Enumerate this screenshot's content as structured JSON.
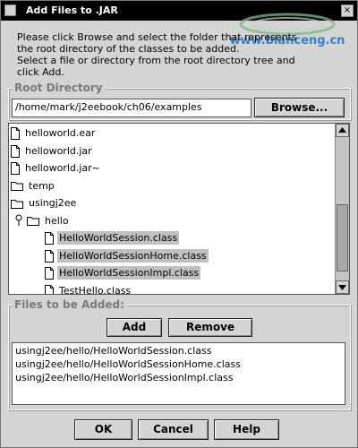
{
  "window": {
    "title": "Add Files to .JAR",
    "close_glyph": "×"
  },
  "watermark": {
    "text": "www.bianceng.cn"
  },
  "instructions": [
    "Please click Browse and select the folder that represents",
    "the root directory of the classes to be added.",
    "Select a file or directory from the root directory tree and",
    "click Add."
  ],
  "root_directory": {
    "group_label": "Root Directory",
    "path_value": "/home/mark/j2eebook/ch06/examples",
    "browse_label": "Browse..."
  },
  "tree": {
    "rows": [
      {
        "label": "helloworld.ear",
        "icon": "file-icon",
        "selected": false
      },
      {
        "label": "helloworld.jar",
        "icon": "file-icon",
        "selected": false
      },
      {
        "label": "helloworld.jar~",
        "icon": "file-icon",
        "selected": false
      },
      {
        "label": "temp",
        "icon": "folder-icon",
        "selected": false
      },
      {
        "label": "usingj2ee",
        "icon": "folder-icon",
        "selected": false
      },
      {
        "label": "hello",
        "icon": "folder-icon",
        "selected": false
      },
      {
        "label": "HelloWorldSession.class",
        "icon": "file-icon",
        "selected": true
      },
      {
        "label": "HelloWorldSessionHome.class",
        "icon": "file-icon",
        "selected": true
      },
      {
        "label": "HelloWorldSessionImpl.class",
        "icon": "file-icon",
        "selected": true
      },
      {
        "label": "TestHello.class",
        "icon": "file-icon",
        "selected": false
      }
    ],
    "scroll_position": 0.55
  },
  "files_to_add": {
    "group_label": "Files to be Added:",
    "add_label": "Add",
    "remove_label": "Remove",
    "items": [
      "usingj2ee/hello/HelloWorldSession.class",
      "usingj2ee/hello/HelloWorldSessionHome.class",
      "usingj2ee/hello/HelloWorldSessionImpl.class"
    ]
  },
  "buttons": {
    "ok_label": "OK",
    "cancel_label": "Cancel",
    "help_label": "Help"
  },
  "colors": {
    "title_bar": "#000000",
    "dialog_bg": "#d4d4d4",
    "selection": "#c0c0c0",
    "group_label": "#7a7a7a",
    "watermark_blue": "#1a73c8"
  }
}
